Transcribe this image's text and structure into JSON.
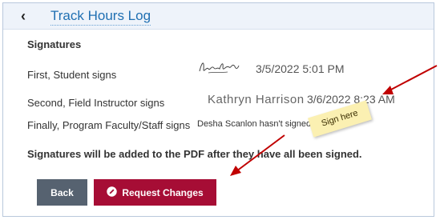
{
  "header": {
    "title": "Track Hours Log",
    "back_icon": "chevron-left-icon"
  },
  "signatures": {
    "heading": "Signatures",
    "rows": [
      {
        "label": "First, Student signs",
        "time": "3/5/2022 5:01 PM"
      },
      {
        "label": "Second, Field Instructor signs",
        "name": "Kathryn Harrison",
        "time": "3/6/2022 8:23 AM"
      },
      {
        "label": "Finally, Program Faculty/Staff signs",
        "status": "Desha Scanlon hasn't signed yet"
      }
    ],
    "sticky_note": "Sign here"
  },
  "note": "Signatures will be added to the PDF after they have all been signed.",
  "buttons": {
    "back": "Back",
    "request_changes": "Request Changes"
  },
  "colors": {
    "accent": "#a60d35",
    "back_button": "#566270",
    "link": "#1f6fb2",
    "annotation_arrow": "#c00000"
  }
}
